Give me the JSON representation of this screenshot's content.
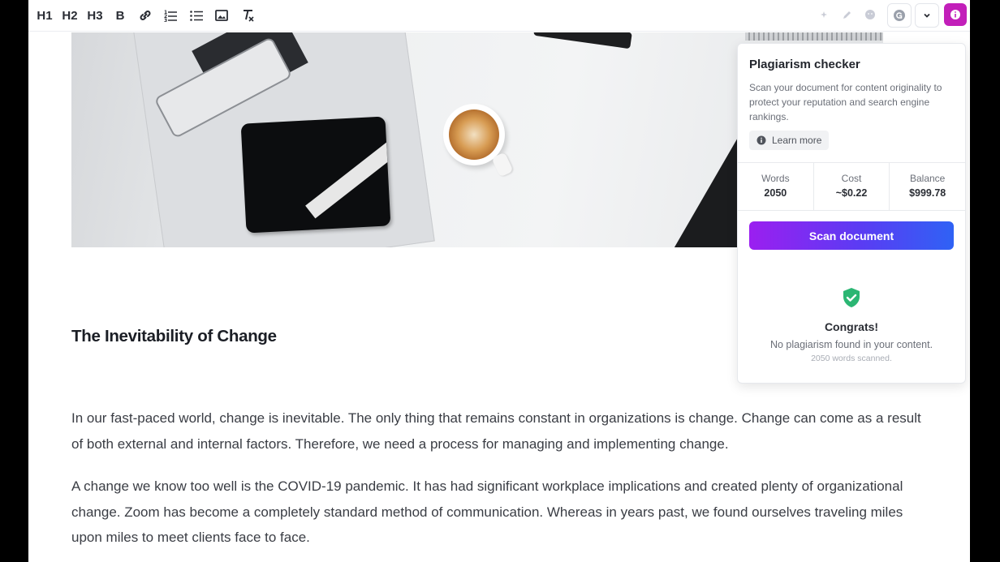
{
  "toolbar": {
    "h1_label": "H1",
    "h2_label": "H2",
    "h3_label": "H3",
    "bold_label": "B",
    "icons": [
      "link-icon",
      "ordered-list-icon",
      "bullet-list-icon",
      "image-icon",
      "clear-format-icon",
      "magic-icon",
      "pencil-icon",
      "emoji-icon",
      "grammarly-icon",
      "chevron-down-icon",
      "info-icon"
    ],
    "accent_color": "#c21fb9"
  },
  "document": {
    "heading": "The Inevitability of Change",
    "paragraphs": [
      "In our fast-paced world, change is inevitable. The only thing that remains constant in organizations is change. Change can come as a result of both external and internal factors. Therefore, we need a process for managing and implementing change.",
      "A change we know too well is the COVID-19 pandemic. It has had significant workplace implications and created plenty of organizational change. Zoom has become a completely standard method of communication. Whereas in years past, we found ourselves traveling miles upon miles to meet clients face to face."
    ]
  },
  "plagiarism_panel": {
    "title": "Plagiarism checker",
    "description": "Scan your document for content originality to protect your reputation and search engine rankings.",
    "learn_more": "Learn more",
    "stats": [
      {
        "label": "Words",
        "value": "2050"
      },
      {
        "label": "Cost",
        "value": "~$0.22"
      },
      {
        "label": "Balance",
        "value": "$999.78"
      }
    ],
    "scan_button": "Scan document",
    "result_title": "Congrats!",
    "result_text": "No plagiarism found in your content.",
    "result_sub": "2050 words scanned.",
    "success_color": "#2bb673"
  }
}
